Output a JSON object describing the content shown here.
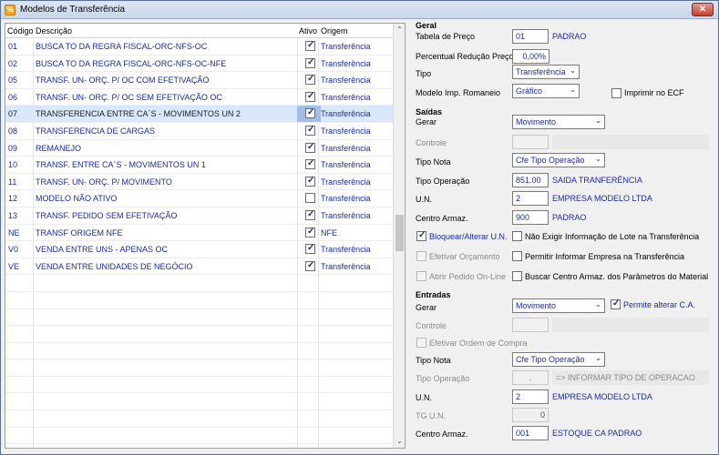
{
  "window": {
    "title": "Modelos de Transferência",
    "close_label": "✕",
    "app_icon_glyph": "%"
  },
  "grid": {
    "headers": {
      "codigo": "Código",
      "descricao": "Descrição",
      "ativo": "Ativo",
      "origem": "Origem"
    },
    "rows": [
      {
        "code": "01",
        "desc": "BUSCA TO DA REGRA FISCAL-ORC-NFS-OC",
        "ativo": true,
        "origem": "Transferência"
      },
      {
        "code": "02",
        "desc": "BUSCA TO DA REGRA FISCAL-ORC-NFS-OC-NFE",
        "ativo": true,
        "origem": "Transferência"
      },
      {
        "code": "05",
        "desc": "TRANSF. UN- ORÇ. P/ OC COM EFETIVAÇÃO",
        "ativo": true,
        "origem": "Transferência"
      },
      {
        "code": "06",
        "desc": "TRANSF. UN- ORÇ. P/ OC SEM EFETIVAÇÃO OC",
        "ativo": true,
        "origem": "Transferência"
      },
      {
        "code": "07",
        "desc": "TRANSFERENCIA ENTRE CA´S - MOVIMENTOS UN 2",
        "ativo": true,
        "origem": "Transferência",
        "selected": true
      },
      {
        "code": "08",
        "desc": "TRANSFERENCIA DE CARGAS",
        "ativo": true,
        "origem": "Transferência"
      },
      {
        "code": "09",
        "desc": "REMANEJO",
        "ativo": true,
        "origem": "Transferência"
      },
      {
        "code": "10",
        "desc": "TRANSF. ENTRE CA´S - MOVIMENTOS UN 1",
        "ativo": true,
        "origem": "Transferência"
      },
      {
        "code": "11",
        "desc": "TRANSF. UN- ORÇ. P/ MOVIMENTO",
        "ativo": true,
        "origem": "Transferência"
      },
      {
        "code": "12",
        "desc": "MODELO NÃO ATIVO",
        "ativo": false,
        "origem": "Transferência"
      },
      {
        "code": "13",
        "desc": "TRANSF. PEDIDO SEM EFETIVAÇÃO",
        "ativo": true,
        "origem": "Transferência"
      },
      {
        "code": "NE",
        "desc": "TRANSF ORIGEM NFE",
        "ativo": true,
        "origem": "NFE"
      },
      {
        "code": "V0",
        "desc": "VENDA ENTRE UNS - APENAS OC",
        "ativo": true,
        "origem": "Transferência"
      },
      {
        "code": "VE",
        "desc": "VENDA ENTRE UNIDADES DE NEGÓCIO",
        "ativo": true,
        "origem": "Transferência"
      }
    ],
    "empty_rows": 10
  },
  "form": {
    "geral": {
      "title": "Geral",
      "tabela_preco_label": "Tabela de Preço",
      "tabela_preco_value": "01",
      "tabela_preco_desc": "PADRAO",
      "perc_reducao_label": "Percentual Redução Preço",
      "perc_reducao_value": "0,00%",
      "tipo_label": "Tipo",
      "tipo_value": "Transferência",
      "modelo_label": "Modelo Imp. Romaneio",
      "modelo_value": "Gráfico",
      "imprimir_ecf_label": "Imprimir no ECF"
    },
    "saidas": {
      "title": "Saídas",
      "gerar_label": "Gerar",
      "gerar_value": "Movimento",
      "controle_label": "Controle",
      "tipo_nota_label": "Tipo Nota",
      "tipo_nota_value": "Cfe Tipo Operação",
      "tipo_operacao_label": "Tipo Operação",
      "tipo_operacao_value": "851.00",
      "tipo_operacao_desc": "SAIDA TRANFERÊNCIA",
      "un_label": "U.N.",
      "un_value": "2",
      "un_desc": "EMPRESA MODELO LTDA",
      "centro_label": "Centro Armaz.",
      "centro_value": "900",
      "centro_desc": "PADRAO",
      "bloquear_label": "Bloquear/Alterar U.N.",
      "nao_exigir_label": "Não Exigir Informação de Lote na Transferência",
      "efetivar_orc_label": "Efetivar Orçamento",
      "permitir_empresa_label": "Permitir Informar Empresa na Transferência",
      "abrir_pedido_label": "Abrir Pedido On-Line",
      "buscar_centro_label": "Buscar Centro Armaz. dos Parâmetros do Material"
    },
    "entradas": {
      "title": "Entradas",
      "gerar_label": "Gerar",
      "gerar_value": "Movimento",
      "permite_alterar_label": "Permite alterar C.A.",
      "controle_label": "Controle",
      "efetivar_ordem_label": "Efetivar Ordem de Compra",
      "tipo_nota_label": "Tipo Nota",
      "tipo_nota_value": "Cfe Tipo Operação",
      "tipo_operacao_label": "Tipo Operação",
      "tipo_operacao_value": ".",
      "tipo_operacao_desc": "=> INFORMAR TIPO DE OPERACAO",
      "un_label": "U.N.",
      "un_value": "2",
      "un_desc": "EMPRESA MODELO LTDA",
      "tg_un_label": "TG U.N.",
      "tg_un_value": "0",
      "centro_label": "Centro Armaz.",
      "centro_value": "001",
      "centro_desc": "ESTOQUE CA PADRAO"
    }
  }
}
